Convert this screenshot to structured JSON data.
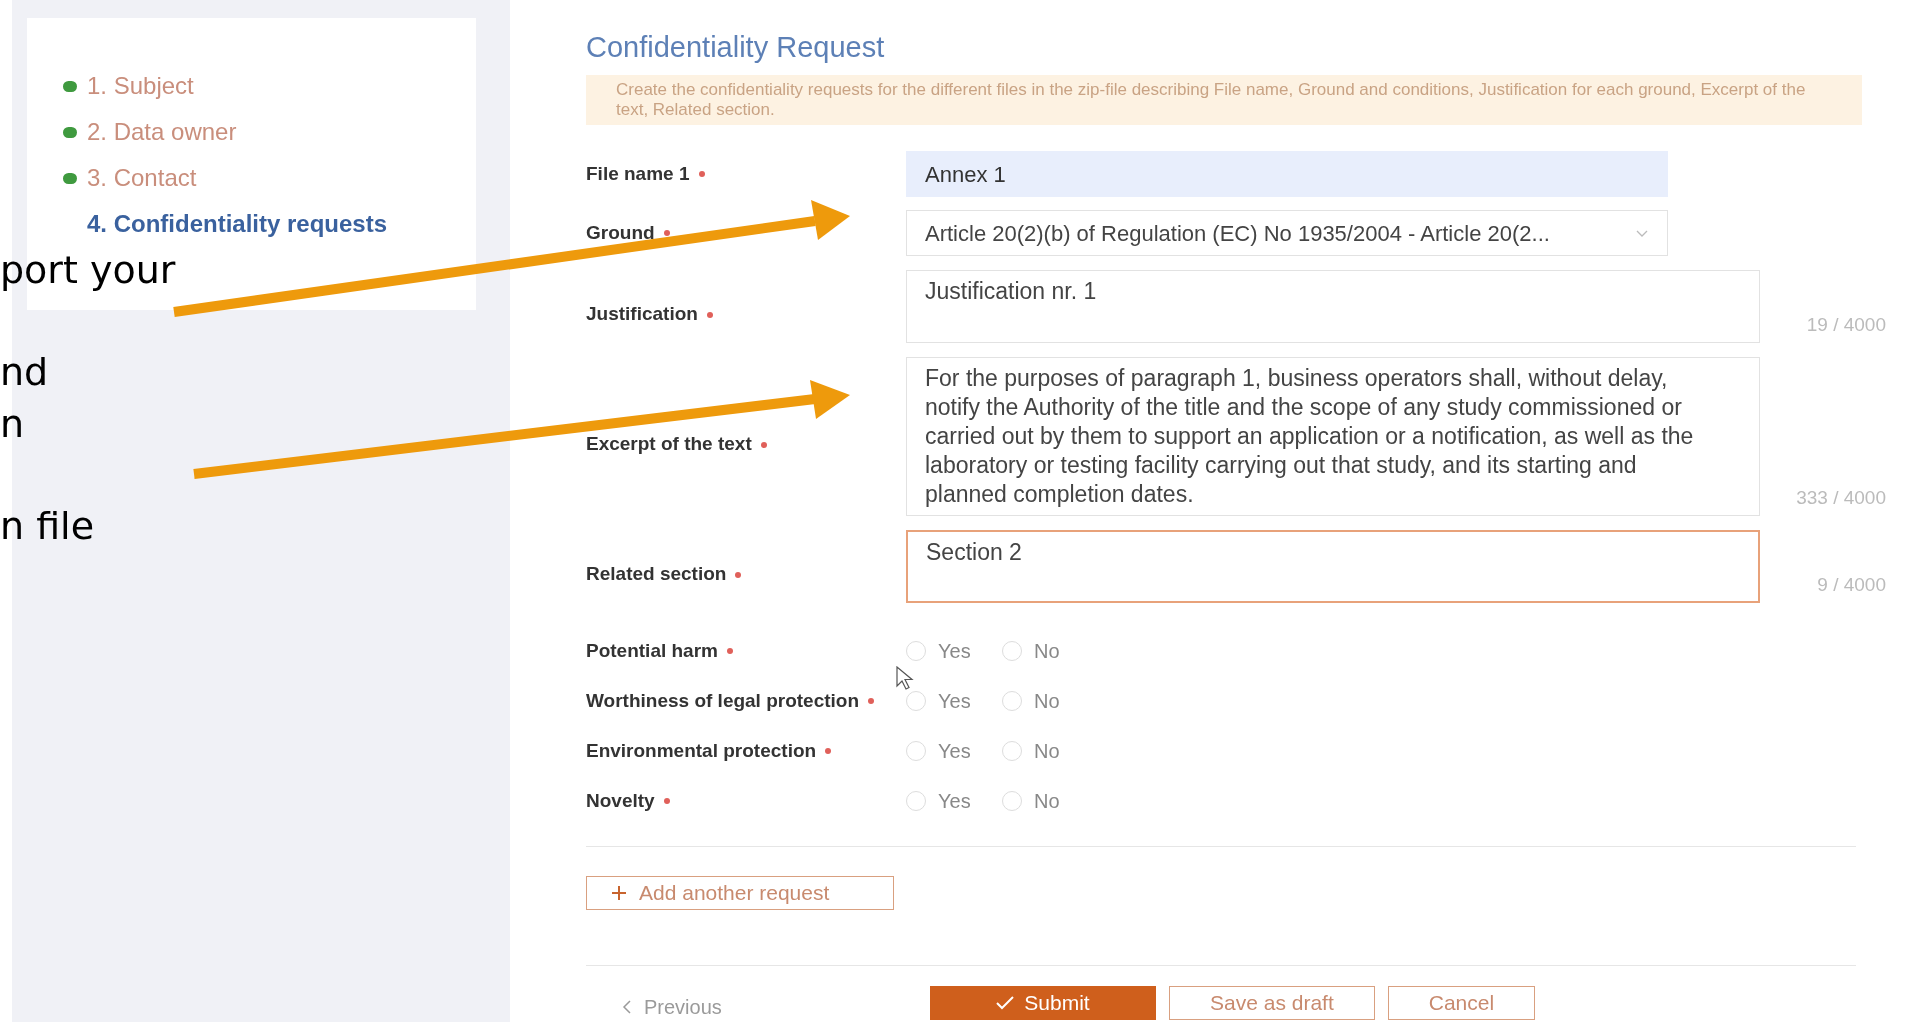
{
  "slide_overlay": {
    "lines": [
      "port your",
      "nd",
      "n",
      "n file"
    ]
  },
  "steps": [
    {
      "label": "1. Subject",
      "completed": true,
      "selected": false
    },
    {
      "label": "2. Data owner",
      "completed": true,
      "selected": false
    },
    {
      "label": "3. Contact",
      "completed": true,
      "selected": false
    },
    {
      "label": "4. Confidentiality requests",
      "completed": false,
      "selected": true
    }
  ],
  "form": {
    "title": "Confidentiality Request",
    "note": "Create the confidentiality requests for the different files in the zip-file describing File name, Ground and conditions, Justification for each ground, Excerpt of the text, Related section.",
    "fields": [
      {
        "kind": "input",
        "label": "File name 1",
        "required": true,
        "value": "Annex 1",
        "autofilled": true
      },
      {
        "kind": "select",
        "label": "Ground",
        "required": true,
        "value": "Article 20(2)(b) of Regulation (EC) No 1935/2004 - Article 20(2..."
      },
      {
        "kind": "textarea",
        "label": "Justification",
        "required": true,
        "value": "Justification nr. 1",
        "counter": "19 / 4000",
        "focused": false
      },
      {
        "kind": "textarea",
        "label": "Excerpt of the text",
        "required": true,
        "value": "For the purposes of paragraph 1, business operators shall, without delay, notify the Authority of the title and the scope of any study commissioned or carried out by them to support an application or a notification, as well as the laboratory or testing facility carrying out that study, and its starting and planned completion dates.",
        "counter": "333 / 4000",
        "focused": false
      },
      {
        "kind": "textarea",
        "label": "Related section",
        "required": true,
        "value": "Section 2",
        "counter": "9 / 4000",
        "focused": true
      }
    ],
    "radio_questions": [
      {
        "label": "Potential harm",
        "required": true,
        "options": [
          {
            "label": "Yes",
            "selected": false
          },
          {
            "label": "No",
            "selected": false
          }
        ]
      },
      {
        "label": "Worthiness of legal protection",
        "required": true,
        "options": [
          {
            "label": "Yes",
            "selected": false
          },
          {
            "label": "No",
            "selected": false
          }
        ]
      },
      {
        "label": "Environmental protection",
        "required": true,
        "options": [
          {
            "label": "Yes",
            "selected": false
          },
          {
            "label": "No",
            "selected": false
          }
        ]
      },
      {
        "label": "Novelty",
        "required": true,
        "options": [
          {
            "label": "Yes",
            "selected": false
          },
          {
            "label": "No",
            "selected": false
          }
        ]
      }
    ],
    "add_button": "Add another request",
    "nav": {
      "previous": "Previous",
      "buttons": [
        {
          "kind": "primary",
          "label": "Submit"
        },
        {
          "kind": "secondary",
          "label": "Save as draft"
        },
        {
          "kind": "secondary",
          "label": "Cancel"
        }
      ]
    }
  }
}
